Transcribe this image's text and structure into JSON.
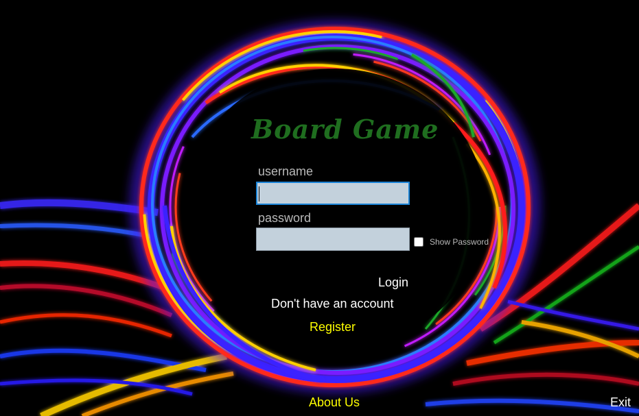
{
  "app": {
    "title": "Board Game"
  },
  "login_form": {
    "username_label": "username",
    "username_value": "",
    "password_label": "password",
    "password_value": "",
    "show_password_label": "Show Password",
    "show_password_checked": false,
    "login_label": "Login",
    "no_account_text": "Don't have an account",
    "register_label": "Register"
  },
  "footer": {
    "about_label": "About Us",
    "exit_label": "Exit"
  },
  "colors": {
    "background": "#000000",
    "title_green": "#1f6e1f",
    "input_fill": "#c3d1dc",
    "focus_border": "#1a83d6",
    "link_yellow": "#ffff00",
    "label_gray": "#b9b9b9"
  }
}
